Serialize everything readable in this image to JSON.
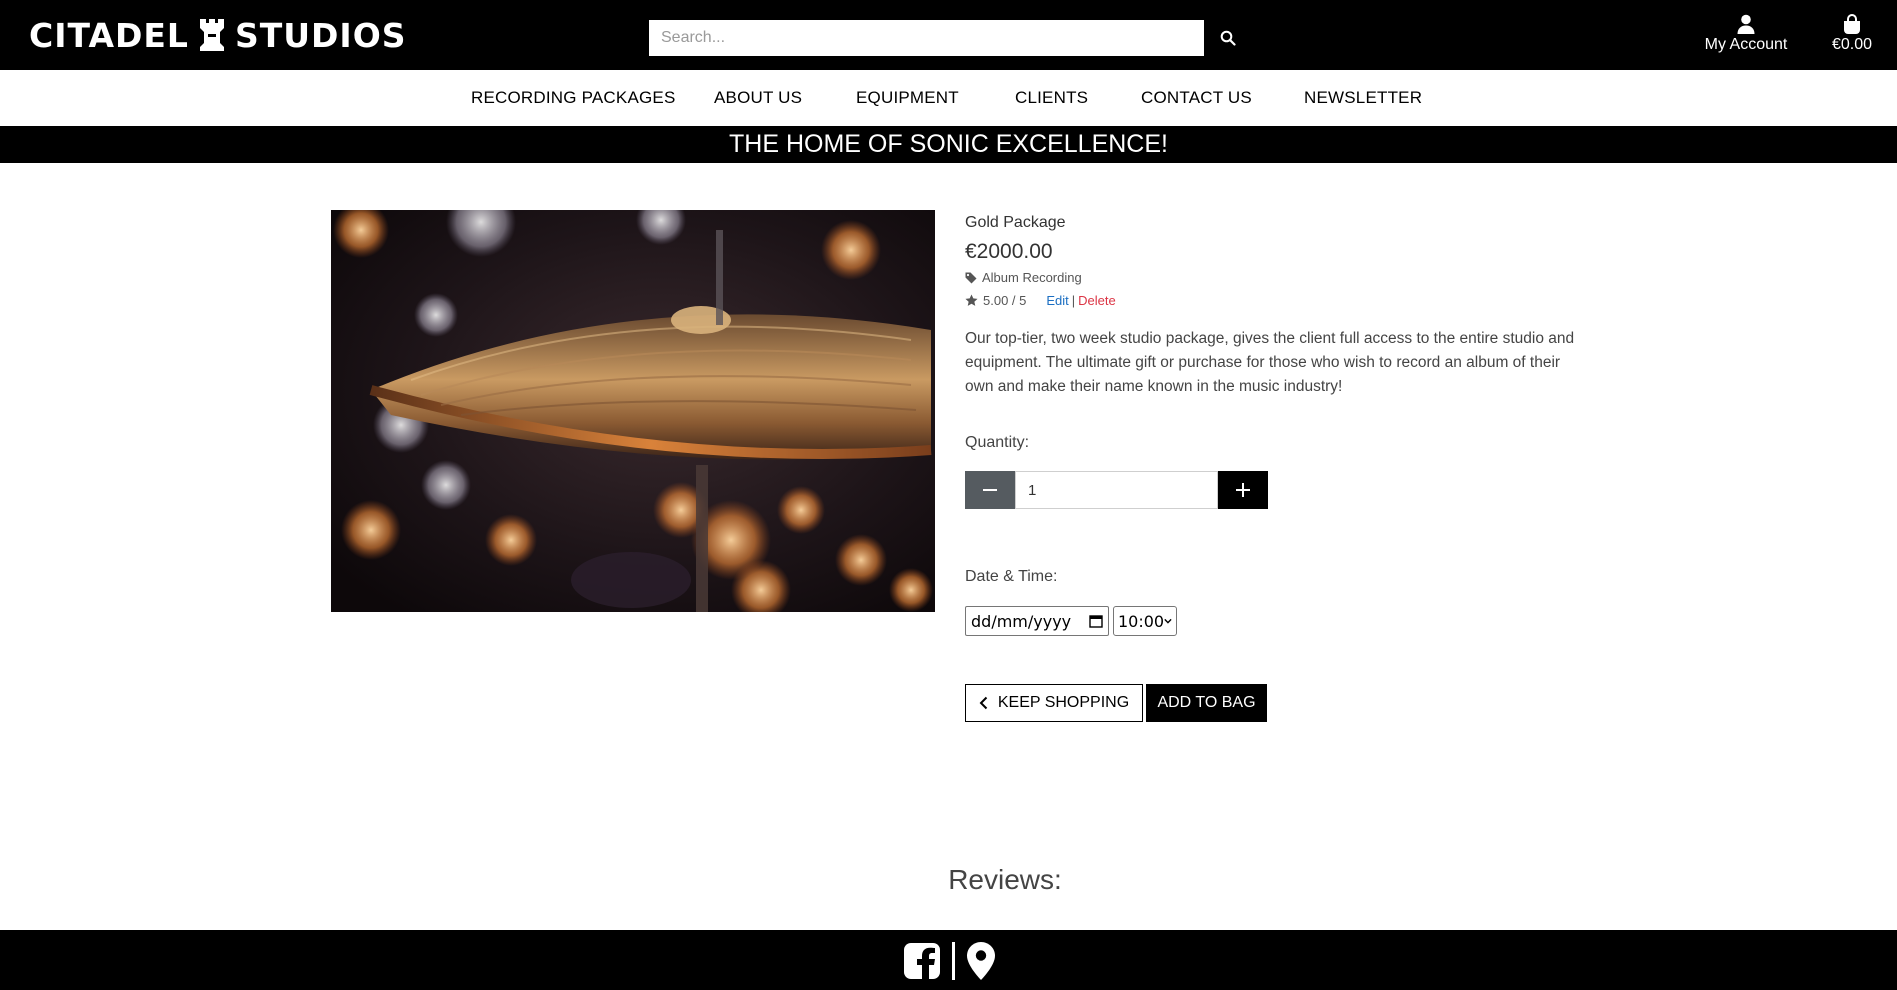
{
  "brand": {
    "name_left": "CITADEL",
    "name_right": "STUDIOS"
  },
  "search": {
    "placeholder": "Search..."
  },
  "header": {
    "account_label": "My Account",
    "bag_total": "€0.00"
  },
  "nav": {
    "items": [
      {
        "label": "RECORDING PACKAGES"
      },
      {
        "label": "ABOUT US"
      },
      {
        "label": "EQUIPMENT"
      },
      {
        "label": "CLIENTS"
      },
      {
        "label": "CONTACT US"
      },
      {
        "label": "NEWSLETTER"
      }
    ]
  },
  "banner": {
    "text": "THE HOME OF SONIC EXCELLENCE!"
  },
  "product": {
    "name": "Gold Package",
    "price": "€2000.00",
    "category": "Album Recording",
    "rating": "5.00 / 5",
    "edit_label": "Edit",
    "separator": "|",
    "delete_label": "Delete",
    "description": "Our top-tier, two week studio package, gives the client full access to the entire studio and equipment. The ultimate gift or purchase for those who wish to record an album of their own and make their name known in the music industry!",
    "image_icon": "cymbal-photo"
  },
  "form": {
    "quantity_label": "Quantity:",
    "quantity_value": "1",
    "datetime_label": "Date & Time:",
    "date_placeholder": "dd/mm/yyyy",
    "time_selected": "10:00",
    "keep_shopping_label": "KEEP SHOPPING",
    "add_to_bag_label": "ADD TO BAG"
  },
  "reviews": {
    "title": "Reviews:"
  },
  "colors": {
    "brand_black": "#000000",
    "edit_link": "#1b6ec2",
    "delete_link": "#dc3545",
    "minus_button": "#555b60"
  },
  "footer": {
    "icons": [
      "facebook-icon",
      "map-marker-icon"
    ]
  }
}
